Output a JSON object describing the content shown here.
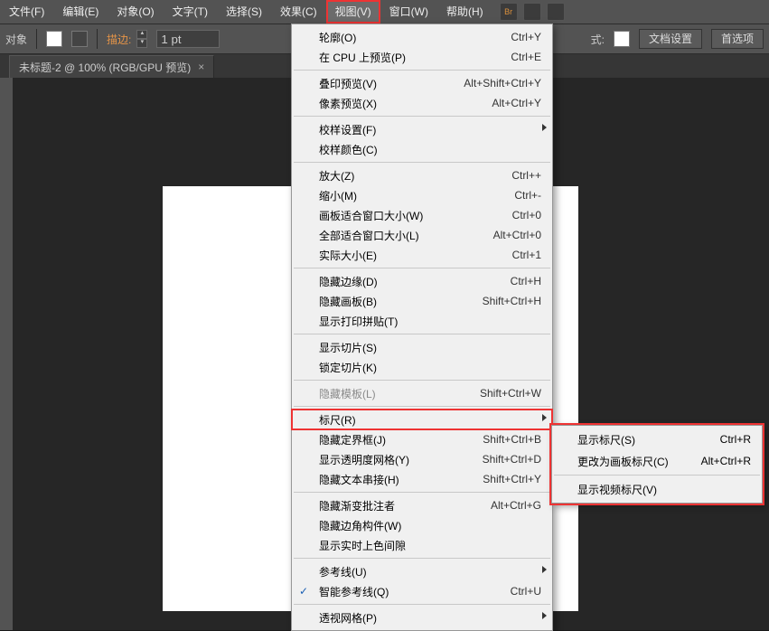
{
  "menubar": {
    "items": [
      {
        "label": "文件(F)"
      },
      {
        "label": "编辑(E)"
      },
      {
        "label": "对象(O)"
      },
      {
        "label": "文字(T)"
      },
      {
        "label": "选择(S)"
      },
      {
        "label": "效果(C)"
      },
      {
        "label": "视图(V)",
        "active": true
      },
      {
        "label": "窗口(W)"
      },
      {
        "label": "帮助(H)"
      }
    ],
    "br_badge": "Br"
  },
  "optionsbar": {
    "target_label": "对象",
    "stroke_label": "描边:",
    "stroke_value": "1 pt",
    "style_label": "式:",
    "doc_setup": "文档设置",
    "prefs": "首选项"
  },
  "tab": {
    "title": "未标题-2 @ 100% (RGB/GPU 预览)",
    "close": "×"
  },
  "view_menu": [
    {
      "type": "item",
      "label": "轮廓(O)",
      "shortcut": "Ctrl+Y"
    },
    {
      "type": "item",
      "label": "在 CPU 上预览(P)",
      "shortcut": "Ctrl+E"
    },
    {
      "type": "sep"
    },
    {
      "type": "item",
      "label": "叠印预览(V)",
      "shortcut": "Alt+Shift+Ctrl+Y"
    },
    {
      "type": "item",
      "label": "像素预览(X)",
      "shortcut": "Alt+Ctrl+Y"
    },
    {
      "type": "sep"
    },
    {
      "type": "item",
      "label": "校样设置(F)",
      "submenu": true
    },
    {
      "type": "item",
      "label": "校样颜色(C)"
    },
    {
      "type": "sep"
    },
    {
      "type": "item",
      "label": "放大(Z)",
      "shortcut": "Ctrl++"
    },
    {
      "type": "item",
      "label": "缩小(M)",
      "shortcut": "Ctrl+-"
    },
    {
      "type": "item",
      "label": "画板适合窗口大小(W)",
      "shortcut": "Ctrl+0"
    },
    {
      "type": "item",
      "label": "全部适合窗口大小(L)",
      "shortcut": "Alt+Ctrl+0"
    },
    {
      "type": "item",
      "label": "实际大小(E)",
      "shortcut": "Ctrl+1"
    },
    {
      "type": "sep"
    },
    {
      "type": "item",
      "label": "隐藏边缘(D)",
      "shortcut": "Ctrl+H"
    },
    {
      "type": "item",
      "label": "隐藏画板(B)",
      "shortcut": "Shift+Ctrl+H"
    },
    {
      "type": "item",
      "label": "显示打印拼贴(T)"
    },
    {
      "type": "sep"
    },
    {
      "type": "item",
      "label": "显示切片(S)"
    },
    {
      "type": "item",
      "label": "锁定切片(K)"
    },
    {
      "type": "sep"
    },
    {
      "type": "item",
      "label": "隐藏模板(L)",
      "shortcut": "Shift+Ctrl+W",
      "disabled": true
    },
    {
      "type": "sep"
    },
    {
      "type": "item",
      "label": "标尺(R)",
      "submenu": true,
      "highlight": true
    },
    {
      "type": "item",
      "label": "隐藏定界框(J)",
      "shortcut": "Shift+Ctrl+B"
    },
    {
      "type": "item",
      "label": "显示透明度网格(Y)",
      "shortcut": "Shift+Ctrl+D"
    },
    {
      "type": "item",
      "label": "隐藏文本串接(H)",
      "shortcut": "Shift+Ctrl+Y"
    },
    {
      "type": "sep"
    },
    {
      "type": "item",
      "label": "隐藏渐变批注者",
      "shortcut": "Alt+Ctrl+G"
    },
    {
      "type": "item",
      "label": "隐藏边角构件(W)"
    },
    {
      "type": "item",
      "label": "显示实时上色间隙"
    },
    {
      "type": "sep"
    },
    {
      "type": "item",
      "label": "参考线(U)",
      "submenu": true
    },
    {
      "type": "item",
      "label": "智能参考线(Q)",
      "shortcut": "Ctrl+U",
      "checked": true
    },
    {
      "type": "sep"
    },
    {
      "type": "item",
      "label": "透视网格(P)",
      "submenu": true
    }
  ],
  "ruler_submenu": [
    {
      "label": "显示标尺(S)",
      "shortcut": "Ctrl+R"
    },
    {
      "label": "更改为画板标尺(C)",
      "shortcut": "Alt+Ctrl+R"
    },
    {
      "type": "sep"
    },
    {
      "label": "显示视频标尺(V)"
    }
  ]
}
